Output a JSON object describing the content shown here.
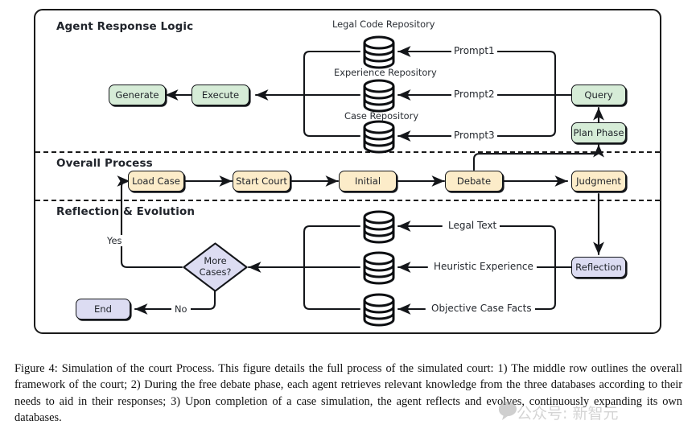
{
  "figure": {
    "sections": [
      {
        "id": "agent-response-logic",
        "title": "Agent Response Logic"
      },
      {
        "id": "overall-process",
        "title": "Overall Process"
      },
      {
        "id": "reflection-evolution",
        "title": "Reflection & Evolution"
      }
    ],
    "colors": {
      "green": "#d6ecd7",
      "yellow": "#fcecc9",
      "purple": "#dcdcf2",
      "stroke": "#14161a",
      "background": "#ffffff"
    },
    "agent_response_logic": {
      "repositories": [
        {
          "label": "Legal Code Repository",
          "prompt": "Prompt1"
        },
        {
          "label": "Experience Repository",
          "prompt": "Prompt2"
        },
        {
          "label": "Case Repository",
          "prompt": "Prompt3"
        }
      ],
      "nodes": [
        {
          "id": "generate",
          "label": "Generate",
          "color": "green"
        },
        {
          "id": "execute",
          "label": "Execute",
          "color": "green"
        },
        {
          "id": "query",
          "label": "Query",
          "color": "green"
        },
        {
          "id": "plan-phase",
          "label": "Plan Phase",
          "color": "green"
        }
      ]
    },
    "overall_process": {
      "steps": [
        {
          "id": "load-case",
          "label": "Load Case",
          "color": "yellow"
        },
        {
          "id": "start-court",
          "label": "Start Court",
          "color": "yellow"
        },
        {
          "id": "initial",
          "label": "Initial",
          "color": "yellow"
        },
        {
          "id": "debate",
          "label": "Debate",
          "color": "yellow"
        },
        {
          "id": "judgment",
          "label": "Judgment",
          "color": "yellow"
        }
      ]
    },
    "reflection_evolution": {
      "databases": [
        {
          "label": "Legal Text"
        },
        {
          "label": "Heuristic Experience"
        },
        {
          "label": "Objective Case Facts"
        }
      ],
      "nodes": [
        {
          "id": "reflection",
          "label": "Reflection",
          "color": "purple"
        },
        {
          "id": "more-cases",
          "label_line1": "More",
          "label_line2": "Cases?",
          "color": "purple"
        },
        {
          "id": "end",
          "label": "End",
          "color": "purple"
        }
      ],
      "branch_labels": {
        "yes": "Yes",
        "no": "No"
      }
    }
  },
  "caption": {
    "text": "Figure 4: Simulation of the court Process. This figure details the full process of the simulated court: 1) The middle row outlines the overall framework of the court; 2) During the free debate phase, each agent retrieves relevant knowledge from the three databases according to their needs to aid in their responses; 3) Upon completion of a case simulation, the agent reflects and evolves, continuously expanding its own databases."
  },
  "watermark": {
    "text": "公众号: 新智元"
  }
}
